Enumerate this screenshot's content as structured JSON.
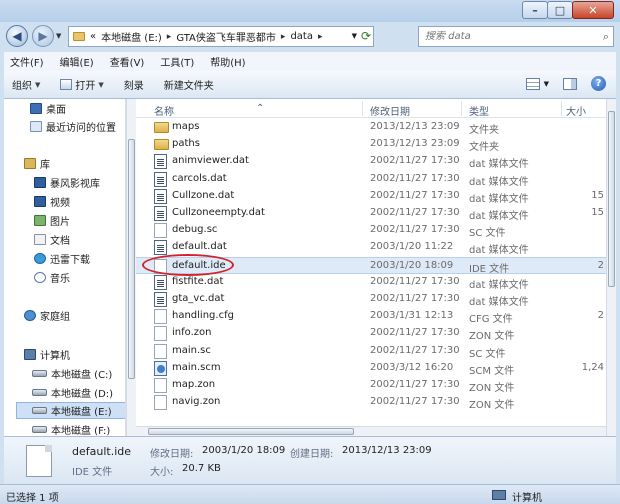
{
  "address": {
    "crumbs": [
      "«",
      "本地磁盘 (E:)",
      "GTA侠盗飞车罪恶都市",
      "data"
    ],
    "search_placeholder": "搜索 data"
  },
  "menu": [
    "文件(F)",
    "编辑(E)",
    "查看(V)",
    "工具(T)",
    "帮助(H)"
  ],
  "toolbar": {
    "organize": "组织",
    "open": "打开",
    "burn": "刻录",
    "new_folder": "新建文件夹"
  },
  "nav": {
    "items": [
      {
        "label": "桌面",
        "icon": "desktop-icon"
      },
      {
        "label": "最近访问的位置",
        "icon": "recent-places-icon"
      },
      {
        "label": "库",
        "icon": "library-icon"
      },
      {
        "label": "暴风影视库",
        "icon": "video-library-icon"
      },
      {
        "label": "视频",
        "icon": "videos-icon"
      },
      {
        "label": "图片",
        "icon": "pictures-icon"
      },
      {
        "label": "文档",
        "icon": "documents-icon"
      },
      {
        "label": "迅雷下载",
        "icon": "download-icon"
      },
      {
        "label": "音乐",
        "icon": "music-icon"
      },
      {
        "label": "家庭组",
        "icon": "homegroup-icon"
      },
      {
        "label": "计算机",
        "icon": "computer-icon"
      },
      {
        "label": "本地磁盘 (C:)",
        "icon": "drive-icon"
      },
      {
        "label": "本地磁盘 (D:)",
        "icon": "drive-icon"
      },
      {
        "label": "本地磁盘 (E:)",
        "icon": "drive-icon"
      },
      {
        "label": "本地磁盘 (F:)",
        "icon": "drive-icon"
      }
    ]
  },
  "columns": {
    "name": "名称",
    "date": "修改日期",
    "type": "类型",
    "size": "大小"
  },
  "files": [
    {
      "name": "maps",
      "date": "2013/12/13 23:09",
      "type": "文件夹",
      "size": "",
      "icon": "folder"
    },
    {
      "name": "paths",
      "date": "2013/12/13 23:09",
      "type": "文件夹",
      "size": "",
      "icon": "folder"
    },
    {
      "name": "animviewer.dat",
      "date": "2002/11/27 17:30",
      "type": "dat 媒体文件",
      "size": "",
      "icon": "dat"
    },
    {
      "name": "carcols.dat",
      "date": "2002/11/27 17:30",
      "type": "dat 媒体文件",
      "size": "",
      "icon": "dat"
    },
    {
      "name": "Cullzone.dat",
      "date": "2002/11/27 17:30",
      "type": "dat 媒体文件",
      "size": "15",
      "icon": "dat"
    },
    {
      "name": "Cullzoneempty.dat",
      "date": "2002/11/27 17:30",
      "type": "dat 媒体文件",
      "size": "15",
      "icon": "dat"
    },
    {
      "name": "debug.sc",
      "date": "2002/11/27 17:30",
      "type": "SC 文件",
      "size": "",
      "icon": "doc"
    },
    {
      "name": "default.dat",
      "date": "2003/1/20 11:22",
      "type": "dat 媒体文件",
      "size": "",
      "icon": "dat"
    },
    {
      "name": "default.ide",
      "date": "2003/1/20 18:09",
      "type": "IDE 文件",
      "size": "2",
      "icon": "doc"
    },
    {
      "name": "fistfite.dat",
      "date": "2002/11/27 17:30",
      "type": "dat 媒体文件",
      "size": "",
      "icon": "dat"
    },
    {
      "name": "gta_vc.dat",
      "date": "2002/11/27 17:30",
      "type": "dat 媒体文件",
      "size": "",
      "icon": "dat"
    },
    {
      "name": "handling.cfg",
      "date": "2003/1/31 12:13",
      "type": "CFG 文件",
      "size": "2",
      "icon": "doc"
    },
    {
      "name": "info.zon",
      "date": "2002/11/27 17:30",
      "type": "ZON 文件",
      "size": "",
      "icon": "doc"
    },
    {
      "name": "main.sc",
      "date": "2002/11/27 17:30",
      "type": "SC 文件",
      "size": "",
      "icon": "doc"
    },
    {
      "name": "main.scm",
      "date": "2003/3/12 16:20",
      "type": "SCM 文件",
      "size": "1,24",
      "icon": "scm"
    },
    {
      "name": "map.zon",
      "date": "2002/11/27 17:30",
      "type": "ZON 文件",
      "size": "",
      "icon": "doc"
    },
    {
      "name": "navig.zon",
      "date": "2002/11/27 17:30",
      "type": "ZON 文件",
      "size": "",
      "icon": "doc"
    }
  ],
  "selected_file": "default.ide",
  "details": {
    "name": "default.ide",
    "type": "IDE 文件",
    "modified_label": "修改日期:",
    "modified_value": "2003/1/20 18:09",
    "size_label": "大小:",
    "size_value": "20.7 KB",
    "created_label": "创建日期:",
    "created_value": "2013/12/13 23:09"
  },
  "status": {
    "selection": "已选择 1 项",
    "location": "计算机"
  },
  "colors": {
    "highlight_circle": "#d2232a",
    "selection_bg": "#dfeaf8"
  }
}
